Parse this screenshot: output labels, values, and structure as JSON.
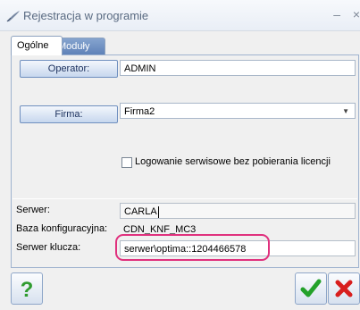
{
  "window": {
    "title": "Rejestracja w programie",
    "icon": "app-feather-icon",
    "controls": {
      "minimize": "–",
      "close": "×"
    }
  },
  "tabs": [
    {
      "label": "Ogólne",
      "active": true
    },
    {
      "label": "Moduły",
      "active": false
    }
  ],
  "form": {
    "operator_button": "Operator:",
    "operator_value": "ADMIN",
    "firma_button": "Firma:",
    "firma_value": "Firma2",
    "checkbox_label": "Logowanie serwisowe bez pobierania licencji",
    "checkbox_checked": false,
    "serwer_label": "Serwer:",
    "serwer_value": "CARLA",
    "baza_label": "Baza konfiguracyjna:",
    "baza_value": "CDN_KNF_MC3",
    "klucza_label": "Serwer klucza:",
    "klucza_value": "serwer\\optima::1204466578"
  },
  "footer": {
    "help_icon": "help-question-icon",
    "ok_icon": "checkmark-icon",
    "cancel_icon": "cancel-x-icon"
  },
  "colors": {
    "highlight": "#e0317e",
    "accent": "#5f82b8",
    "ok_green": "#23a12a",
    "cancel_red": "#d81e1e"
  }
}
